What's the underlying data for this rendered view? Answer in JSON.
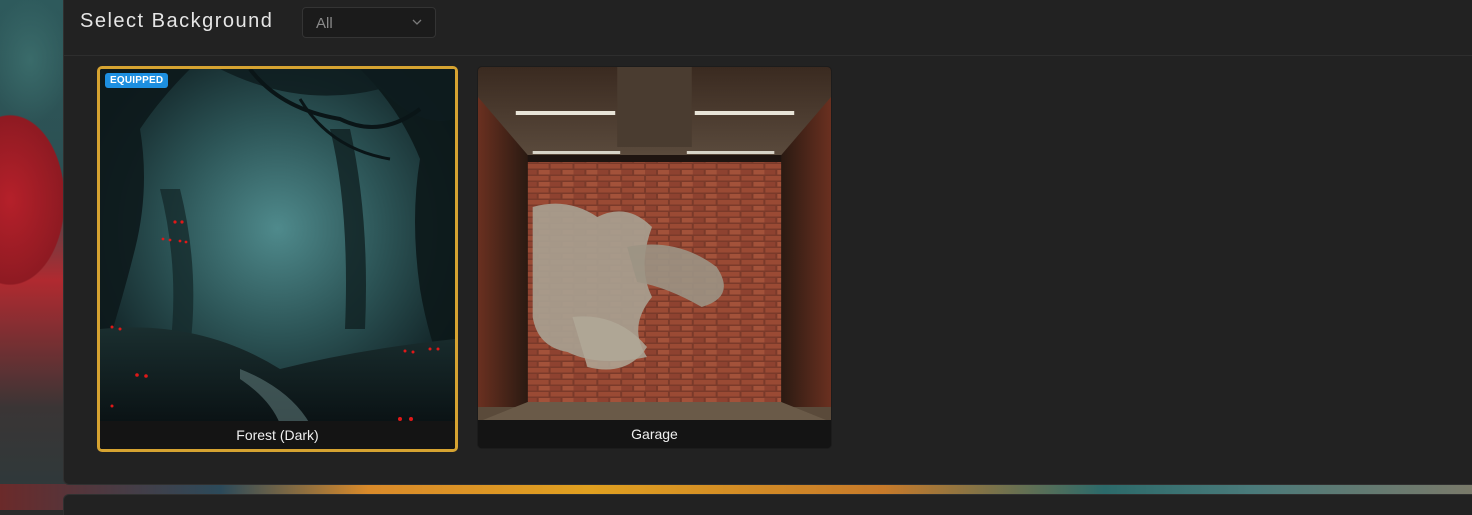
{
  "header": {
    "title": "Select Background",
    "filter": {
      "selected": "All",
      "icon": "chevron-down-icon"
    }
  },
  "backgrounds": [
    {
      "name": "Forest (Dark)",
      "badge": "EQUIPPED",
      "equipped": true
    },
    {
      "name": "Garage",
      "equipped": false
    }
  ],
  "colors": {
    "panel": "#222222",
    "equipped_border": "#d6a331",
    "badge": "#1d8fe0"
  }
}
